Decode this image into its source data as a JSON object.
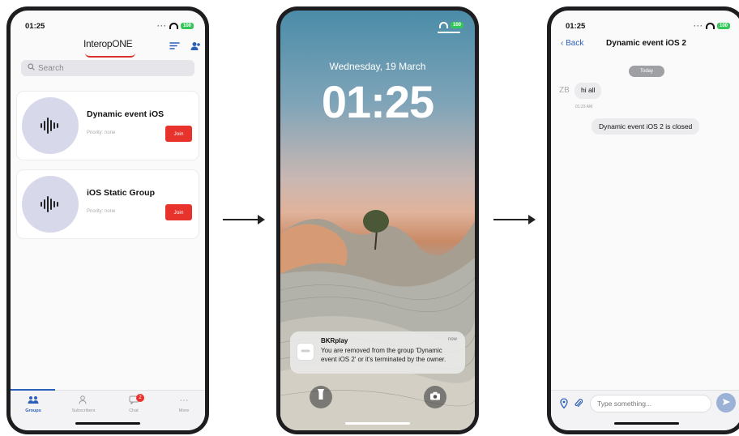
{
  "phone1": {
    "status_time": "01:25",
    "battery": "100",
    "logo_text": "InteropONE",
    "search_placeholder": "Search",
    "groups": [
      {
        "name": "Dynamic event iOS",
        "priority": "Priority: none",
        "join": "Join"
      },
      {
        "name": "iOS Static Group",
        "priority": "Priority: none",
        "join": "Join"
      }
    ],
    "tabs": [
      {
        "label": "Groups",
        "icon": "groups-icon"
      },
      {
        "label": "Subscribers",
        "icon": "subscribers-icon"
      },
      {
        "label": "Chat",
        "icon": "chat-icon",
        "badge": "2"
      },
      {
        "label": "More",
        "icon": "more-icon"
      }
    ]
  },
  "phone2": {
    "battery": "100",
    "date": "Wednesday, 19 March",
    "time": "01:25",
    "notification": {
      "app": "BKRplay",
      "when": "now",
      "message": "You are removed from the group 'Dynamic event iOS 2' or it's terminated by the owner."
    }
  },
  "phone3": {
    "status_time": "01:25",
    "battery": "100",
    "back_label": "Back",
    "title": "Dynamic event iOS 2",
    "date_chip": "Today",
    "sender_initials": "ZB",
    "message": "hi all",
    "message_time": "01:23 AM",
    "system_message": "Dynamic event iOS 2 is closed",
    "input_placeholder": "Type something..."
  },
  "colors": {
    "accent": "#2b5fb8",
    "join": "#e8322c",
    "battery": "#33c75a"
  }
}
